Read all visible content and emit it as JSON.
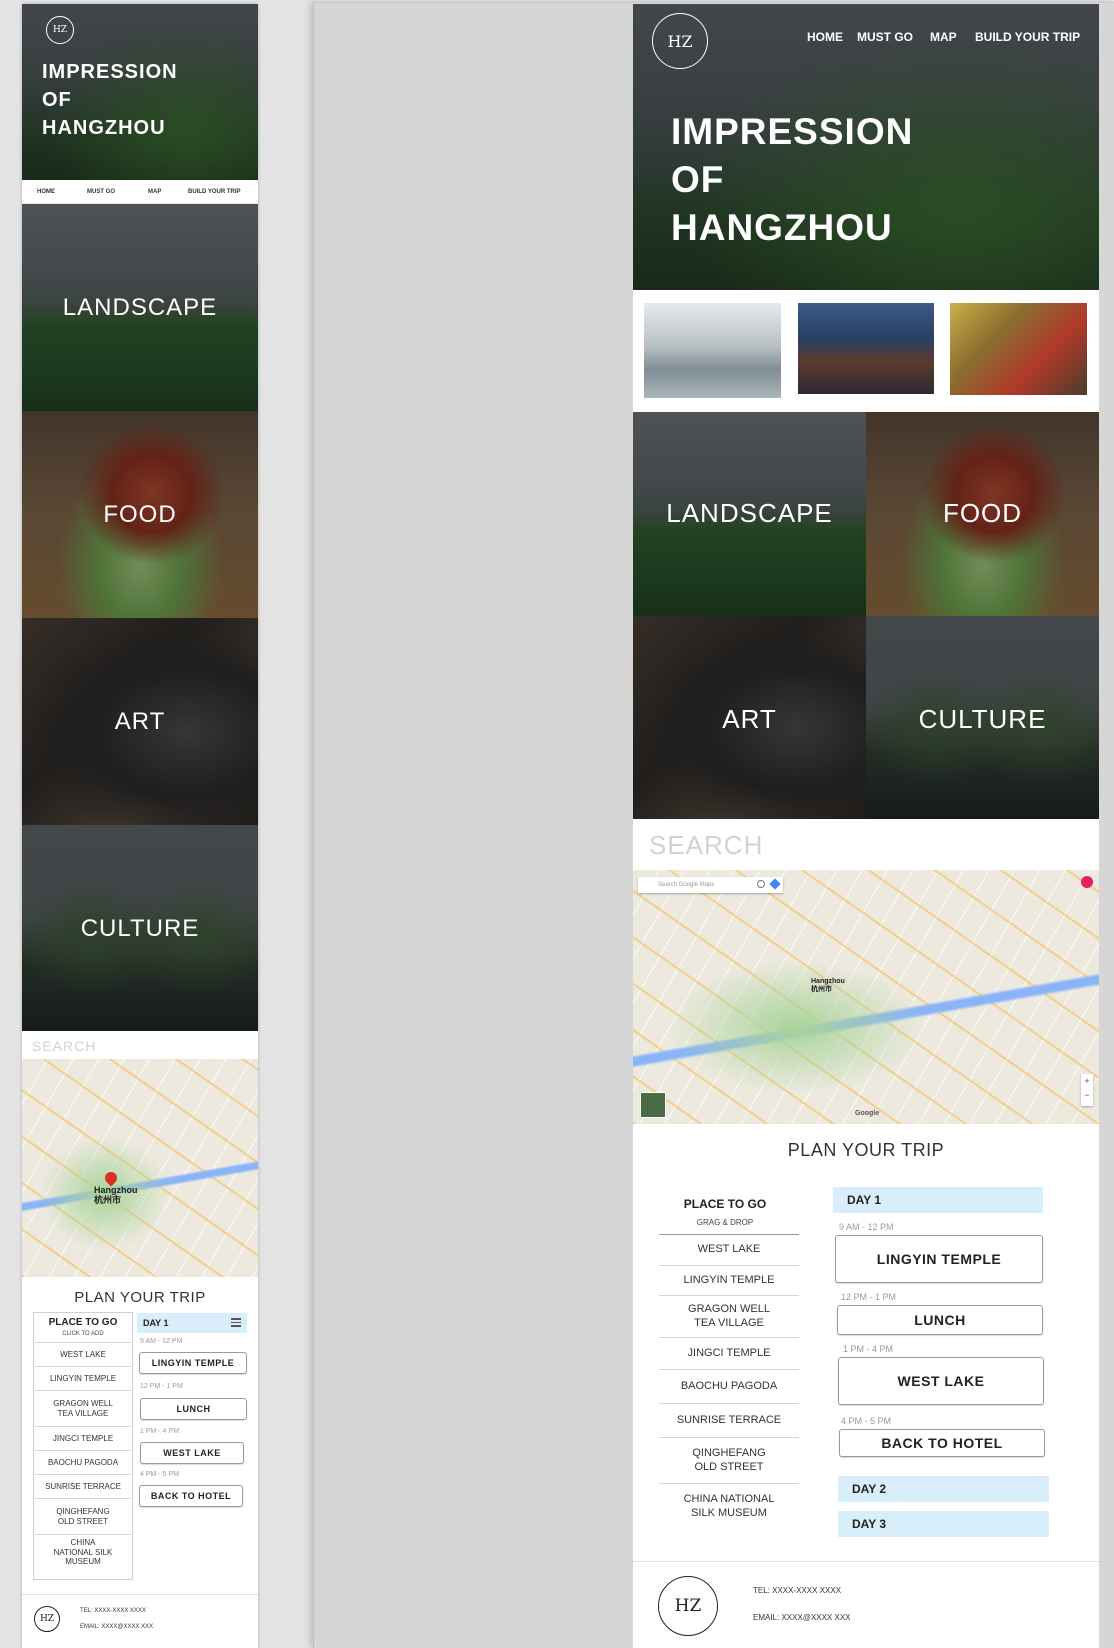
{
  "brand": {
    "logo_text": "HZ",
    "title_lines": [
      "IMPRESSION",
      "OF",
      "HANGZHOU"
    ]
  },
  "nav": {
    "items": [
      "HOME",
      "MUST GO",
      "MAP",
      "BUILD YOUR TRIP"
    ]
  },
  "tiles": {
    "landscape": "LANDSCAPE",
    "food": "FOOD",
    "art": "ART",
    "culture": "CULTURE"
  },
  "search": {
    "label": "SEARCH"
  },
  "map": {
    "search_placeholder": "Search Google Maps",
    "city_label": "Hangzhou",
    "city_label_cn": "杭州市",
    "attribution": "Google"
  },
  "plan": {
    "title": "PLAN YOUR TRIP",
    "places_heading": "PLACE TO GO",
    "places_sub_desktop": "GRAG & DROP",
    "places_sub_mobile": "CLICK TO ADD",
    "places": [
      "WEST  LAKE",
      "LINGYIN TEMPLE",
      "GRAGON WELL TEA VILLAGE",
      "JINGCI TEMPLE",
      "BAOCHU PAGODA",
      "SUNRISE TERRACE",
      "QINGHEFANG OLD STREET",
      "CHINA NATIONAL SILK MUSEUM"
    ],
    "days": [
      "DAY 1",
      "DAY 2",
      "DAY 3"
    ],
    "schedule": [
      {
        "time": "9 AM - 12 PM",
        "place": "LINGYIN TEMPLE"
      },
      {
        "time": "12 PM - 1 PM",
        "place": "LUNCH"
      },
      {
        "time": "1 PM -  4 PM",
        "place": "WEST LAKE"
      },
      {
        "time": "4 PM -  5 PM",
        "place": "BACK TO HOTEL"
      }
    ],
    "menu_icon": "hamburger-icon"
  },
  "footer": {
    "tel": "TEL: XXXX-XXXX XXXX",
    "email": "EMAIL: XXXX@XXXX XXX"
  },
  "colors": {
    "day_bar": "#d8eefa",
    "search_text": "#d2d2d2",
    "map_water": "#8ab4f8"
  }
}
